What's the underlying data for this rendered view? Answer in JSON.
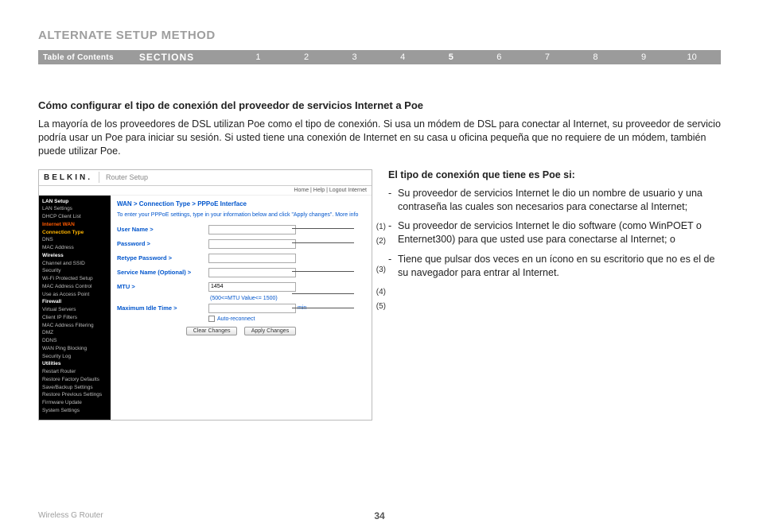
{
  "page": {
    "title": "ALTERNATE SETUP METHOD",
    "footer_product": "Wireless G Router",
    "page_number": "34"
  },
  "nav": {
    "toc_label": "Table of Contents",
    "sections_label": "SECTIONS",
    "numbers": [
      "1",
      "2",
      "3",
      "4",
      "5",
      "6",
      "7",
      "8",
      "9",
      "10"
    ],
    "active_index": 4
  },
  "content": {
    "heading": "Cómo configurar el tipo de conexión del proveedor de servicios Internet a Poe",
    "paragraph": "La mayoría de los proveedores de DSL utilizan Poe como el tipo de conexión. Si usa un módem de DSL para conectar al Internet, su proveedor de servicio podría usar un Poe para iniciar su sesión. Si usted tiene una conexión de Internet en su casa u oficina pequeña que no requiere de un módem, también puede utilizar Poe."
  },
  "router_panel": {
    "brand": "BELKIN",
    "setup_title": "Router Setup",
    "top_links": "Home | Help | Logout  Internet",
    "breadcrumb": "WAN > Connection Type > PPPoE Interface",
    "instruction": "To enter your PPPoE settings, type in your information below and click \"Apply changes\". More info",
    "sidebar": {
      "groups": [
        {
          "cat": "LAN Setup",
          "items": [
            "LAN Settings",
            "DHCP Client List"
          ]
        },
        {
          "cat": "Internet WAN",
          "highlight": true,
          "items": [
            "Connection Type",
            "DNS",
            "MAC Address"
          ],
          "active_item": 0
        },
        {
          "cat": "Wireless",
          "items": [
            "Channel and SSID",
            "Security",
            "Wi-Fi Protected Setup",
            "MAC Address Control",
            "Use as Access Point"
          ]
        },
        {
          "cat": "Firewall",
          "items": [
            "Virtual Servers",
            "Client IP Filters",
            "MAC Address Filtering",
            "DMZ",
            "DDNS",
            "WAN Ping Blocking",
            "Security Log"
          ]
        },
        {
          "cat": "Utilities",
          "items": [
            "Restart Router",
            "Restore Factory Defaults",
            "Save/Backup Settings",
            "Restore Previous Settings",
            "Firmware Update",
            "System Settings"
          ]
        }
      ]
    },
    "fields": [
      {
        "label": "User Name >",
        "value": "",
        "callout": "(1)"
      },
      {
        "label": "Password >",
        "value": "",
        "callout": "(2)"
      },
      {
        "label": "Retype Password >",
        "value": "",
        "callout": ""
      },
      {
        "label": "Service Name (Optional) >",
        "value": "",
        "callout": "(3)"
      },
      {
        "label": "MTU >",
        "value": "1454",
        "callout": "(4)",
        "hint": "(500<=MTU Value<= 1500)"
      },
      {
        "label": "Maximum Idle Time >",
        "value": "",
        "callout": "(5)",
        "hint": "min",
        "checkbox_label": "Auto-reconnect"
      }
    ],
    "buttons": {
      "clear": "Clear Changes",
      "apply": "Apply Changes"
    }
  },
  "right": {
    "heading": "El tipo de conexión que tiene es Poe si:",
    "items": [
      "Su proveedor de servicios Internet le dio un nombre de usuario y una contraseña las cuales son necesarios para conectarse al Internet;",
      "Su proveedor de servicios Internet le dio software (como WinPOET o Enternet300) para que usted use para conectarse al Internet; o",
      "Tiene que pulsar dos veces en un ícono en su escritorio que no es el de su navegador para entrar al Internet."
    ]
  }
}
